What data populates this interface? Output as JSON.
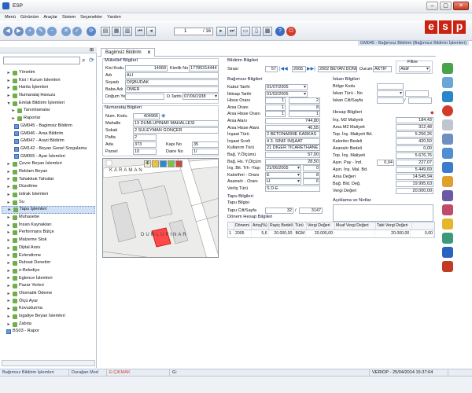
{
  "app": {
    "title": "ESP",
    "menu": [
      "Menü",
      "Görünüm",
      "Araçlar",
      "Sistem",
      "Seçenekler",
      "Yardım"
    ],
    "page": {
      "current": "1",
      "total": "/ 16"
    },
    "logo": [
      "e",
      "s",
      "p"
    ]
  },
  "window_title": "GM045 - Bağımsız Bildirim (Bağımsız Bildirim İşlemleri)",
  "tree": [
    {
      "label": "Yönetim",
      "lv": 1,
      "icon": "plus"
    },
    {
      "label": "Kisi / Kurum Islemleri",
      "lv": 1,
      "icon": "plus"
    },
    {
      "label": "Harita İşlemleri",
      "lv": 1,
      "icon": "plus"
    },
    {
      "label": "Numarataj Havuzu",
      "lv": 1,
      "icon": "plus"
    },
    {
      "label": "Emlak Bildirim İşlemleri",
      "lv": 1,
      "icon": "minus"
    },
    {
      "label": "Tanımlamalar",
      "lv": 2,
      "icon": "plus"
    },
    {
      "label": "Raporlar",
      "lv": 2,
      "icon": "plus"
    },
    {
      "label": "GM045 - Bagimsiz Bildirim",
      "lv": 3,
      "icon": "form"
    },
    {
      "label": "GM046 - Arsa Bildirim",
      "lv": 3,
      "icon": "form"
    },
    {
      "label": "GM047 - Arazi Bildirim",
      "lv": 3,
      "icon": "form"
    },
    {
      "label": "GM142 - Beyan Genel Sorgulama",
      "lv": 3,
      "icon": "form"
    },
    {
      "label": "GM055 - Ayar İslemleri",
      "lv": 3,
      "icon": "form"
    },
    {
      "label": "Çevre Beyan İslemleri",
      "lv": 1,
      "icon": "plus"
    },
    {
      "label": "Reklam Beyan",
      "lv": 1,
      "icon": "plus"
    },
    {
      "label": "Tahakkuk Tahsilat",
      "lv": 1,
      "icon": "plus"
    },
    {
      "label": "Düzeltme",
      "lv": 1,
      "icon": "plus"
    },
    {
      "label": "Istirak Islemleri",
      "lv": 1,
      "icon": "plus"
    },
    {
      "label": "Su",
      "lv": 1,
      "icon": "plus"
    },
    {
      "label": "Tapu İşlemleri",
      "lv": 1,
      "icon": "plus",
      "sel": true
    },
    {
      "label": "Muhasebe",
      "lv": 1,
      "icon": "plus"
    },
    {
      "label": "İnsan Kaynakları",
      "lv": 1,
      "icon": "plus"
    },
    {
      "label": "Performans Bütçe",
      "lv": 1,
      "icon": "plus"
    },
    {
      "label": "Malzeme Stok",
      "lv": 1,
      "icon": "plus"
    },
    {
      "label": "Dijital Arsiv",
      "lv": 1,
      "icon": "plus"
    },
    {
      "label": "Evlendirme",
      "lv": 1,
      "icon": "plus"
    },
    {
      "label": "Ruhsat Denetim",
      "lv": 1,
      "icon": "plus"
    },
    {
      "label": "e-Belediye",
      "lv": 1,
      "icon": "plus"
    },
    {
      "label": "Eglence İslemleri",
      "lv": 1,
      "icon": "plus"
    },
    {
      "label": "Pazar Yerleri",
      "lv": 1,
      "icon": "plus"
    },
    {
      "label": "Otomatik Ödeme",
      "lv": 1,
      "icon": "plus"
    },
    {
      "label": "Ölçü Ayar",
      "lv": 1,
      "icon": "plus"
    },
    {
      "label": "Kovusturma",
      "lv": 1,
      "icon": "plus"
    },
    {
      "label": "Isgaliye Beyan İslemleri",
      "lv": 1,
      "icon": "plus"
    },
    {
      "label": "Zabıta",
      "lv": 1,
      "icon": "plus"
    },
    {
      "label": "BS03 - Rapor",
      "lv": 1,
      "icon": "form"
    }
  ],
  "tab": {
    "label": "Bagimsiz Bildirim",
    "close": "x"
  },
  "mukellef": {
    "title": "Mükellef Bilgileri",
    "kisi_kodu_l": "Kisi Kodu",
    "kisi_kodu": "14068",
    "kimlik_l": "Kimlik No",
    "kimlik": "17785314444",
    "adi_l": "Adı",
    "adi": "ALİ",
    "soyadi_l": "Soyadı",
    "soyadi": "DİŞBUDAK",
    "baba_l": "Baba Adı",
    "baba": "ÖMER",
    "dogum_l": "Doğum Yeri",
    "dtarih_l": "D.Tarihi",
    "dtarih": "07/06/1938"
  },
  "numarataj": {
    "title": "Numarataj Bilgileri",
    "num_l": "Num. Kodu",
    "num": "404966",
    "mahalle_l": "Mahalle",
    "mahalle": "19 DUMLUPINAR MAHALLESİ",
    "sokak_l": "Sokak",
    "sokak": "2 SÜLEYMAN GÖNÇER",
    "pafta_l": "Pafta",
    "pafta": "2",
    "ada_l": "Ada",
    "ada": "373",
    "kapi_l": "Kapı No",
    "kapi": "35",
    "parsel_l": "Parsel",
    "parsel": "10",
    "daire_l": "Daire No",
    "daire": "1/"
  },
  "map": {
    "labels": [
      "KARAMAN",
      "DUMLUPINAR"
    ]
  },
  "bildirim": {
    "title": "Bildirim Bilgileri",
    "sirasi_l": "Sirasi",
    "sirasi": "57",
    "yil": "2005",
    "donem": "2002 BEYAN DÖNEMI",
    "durum_l": "Durum",
    "durum": "AKTIF",
    "filtre_l": "Filtre",
    "filtre": "Aktif"
  },
  "bagimsiz": {
    "title": "Bağımsız Bilgileri",
    "rows": [
      {
        "l": "Kabul Tarihi",
        "v": "01/07/2005",
        "t": "dd"
      },
      {
        "l": "İktisap Tarihi",
        "v": "01/02/2005",
        "t": "dd"
      },
      {
        "l": "Hisse Oranı",
        "v": "1",
        "v2": "2",
        "t": "pair"
      },
      {
        "l": "Arsa Oranı",
        "v": "1",
        "v2": "8",
        "t": "pair"
      },
      {
        "l": "Arsa Hisse Oranı",
        "v": "1",
        "v2": "1",
        "t": "pair"
      },
      {
        "l": "Arsa Alanı",
        "v": "744,80",
        "t": "num"
      },
      {
        "l": "Arsa Hisse Alanı",
        "v": "46,55",
        "t": "num"
      },
      {
        "l": "İnşaat Türü",
        "v": "2 BETONARME KARKAS",
        "t": "txt"
      },
      {
        "l": "İnşaat Sınıfı",
        "v": "4 3. SINIF İNŞAAT",
        "t": "txt"
      },
      {
        "l": "Kullanım Türü",
        "v": "21 DİĞER TİCARETHANE VE",
        "t": "txt"
      },
      {
        "l": "Bağ. Y.Ölçümü",
        "v": "57,00",
        "t": "num"
      },
      {
        "l": "Bağ. Hs. Y.Ölçüm",
        "v": "28,50",
        "t": "num"
      },
      {
        "l": "İnş. Bit. Trh -Yaşı",
        "v": "21/06/2005",
        "v2": "0",
        "t": "ddn"
      },
      {
        "l": "Kaloriferi - Oranı",
        "v": "E",
        "v2": "8",
        "t": "ddn"
      },
      {
        "l": "Asansör - Oranı",
        "v": "H",
        "v2": "6",
        "t": "ddn"
      },
      {
        "l": "Verliş Türü",
        "v": "S D-E",
        "t": "txt"
      }
    ]
  },
  "tapu": {
    "title": "Tapu Bilgileri",
    "tapu_l": "Tapu Bilgisi",
    "cilt_l": "Tapu Cilt/Sayfa",
    "cilt": "32",
    "sayfa": "3147"
  },
  "iskan": {
    "title": "İskan Bilgileri",
    "rows": [
      "Bölge Kodu",
      "İskan Türü - No",
      "İskan Cilt/Sayfa"
    ]
  },
  "hesap": {
    "title": "Hesap Bilgileri",
    "rows": [
      {
        "l": "İnş. M2 Maliyeti",
        "v": "184,43"
      },
      {
        "l": "Arsa M2 Maliyeti",
        "v": "312,48"
      },
      {
        "l": "Top. İnş. Maliyeti Bd.",
        "v": "5.256,26"
      },
      {
        "l": "Kaloriter Bedeli",
        "v": "420,50"
      },
      {
        "l": "Asansör Bedeli",
        "v": "0,00"
      },
      {
        "l": "Top. İnş. Maliyeti",
        "v": "5.676,76"
      },
      {
        "l": "Aşın. Pay - İnd.",
        "v0": "0,04",
        "v": "227,07"
      },
      {
        "l": "Aşın. İnş. Mal. Bd.",
        "v": "5.449,69"
      },
      {
        "l": "Arsa Değeri",
        "v": "14.545,94"
      },
      {
        "l": "Bağ. Bld. Değ.",
        "v": "19.995,63"
      },
      {
        "l": "Vergi Değeri",
        "v": "20.000,00"
      }
    ]
  },
  "aciklama": {
    "title": "Açıklama ve Notlar"
  },
  "donem": {
    "title": "Dönem Hesap Bilgileri",
    "cols": [
      "",
      "Dönemi",
      "Artış(%)",
      "Rayiç Bedeli",
      "Türü",
      "Vergi Değeri",
      "Muaf Vergi Değeri",
      "Tabi Vergi Değeri"
    ],
    "rows": [
      [
        "1",
        "2005",
        "5,6",
        "20.000,00",
        "BGM",
        "20.000,00",
        "",
        "20.000,00",
        "0,00"
      ]
    ]
  },
  "status": {
    "c1": "Bağımsız Bildirim İşlemleri",
    "c2": "Durağan Mod",
    "c3": "E:ÇIKMAK",
    "c4": "G:",
    "c5": "VERIOP - 25/04/2014 15:37:04"
  },
  "colors": {
    "accent": "#2a62c0",
    "brand": "#cc2211",
    "selection": "#cfe0f7"
  }
}
